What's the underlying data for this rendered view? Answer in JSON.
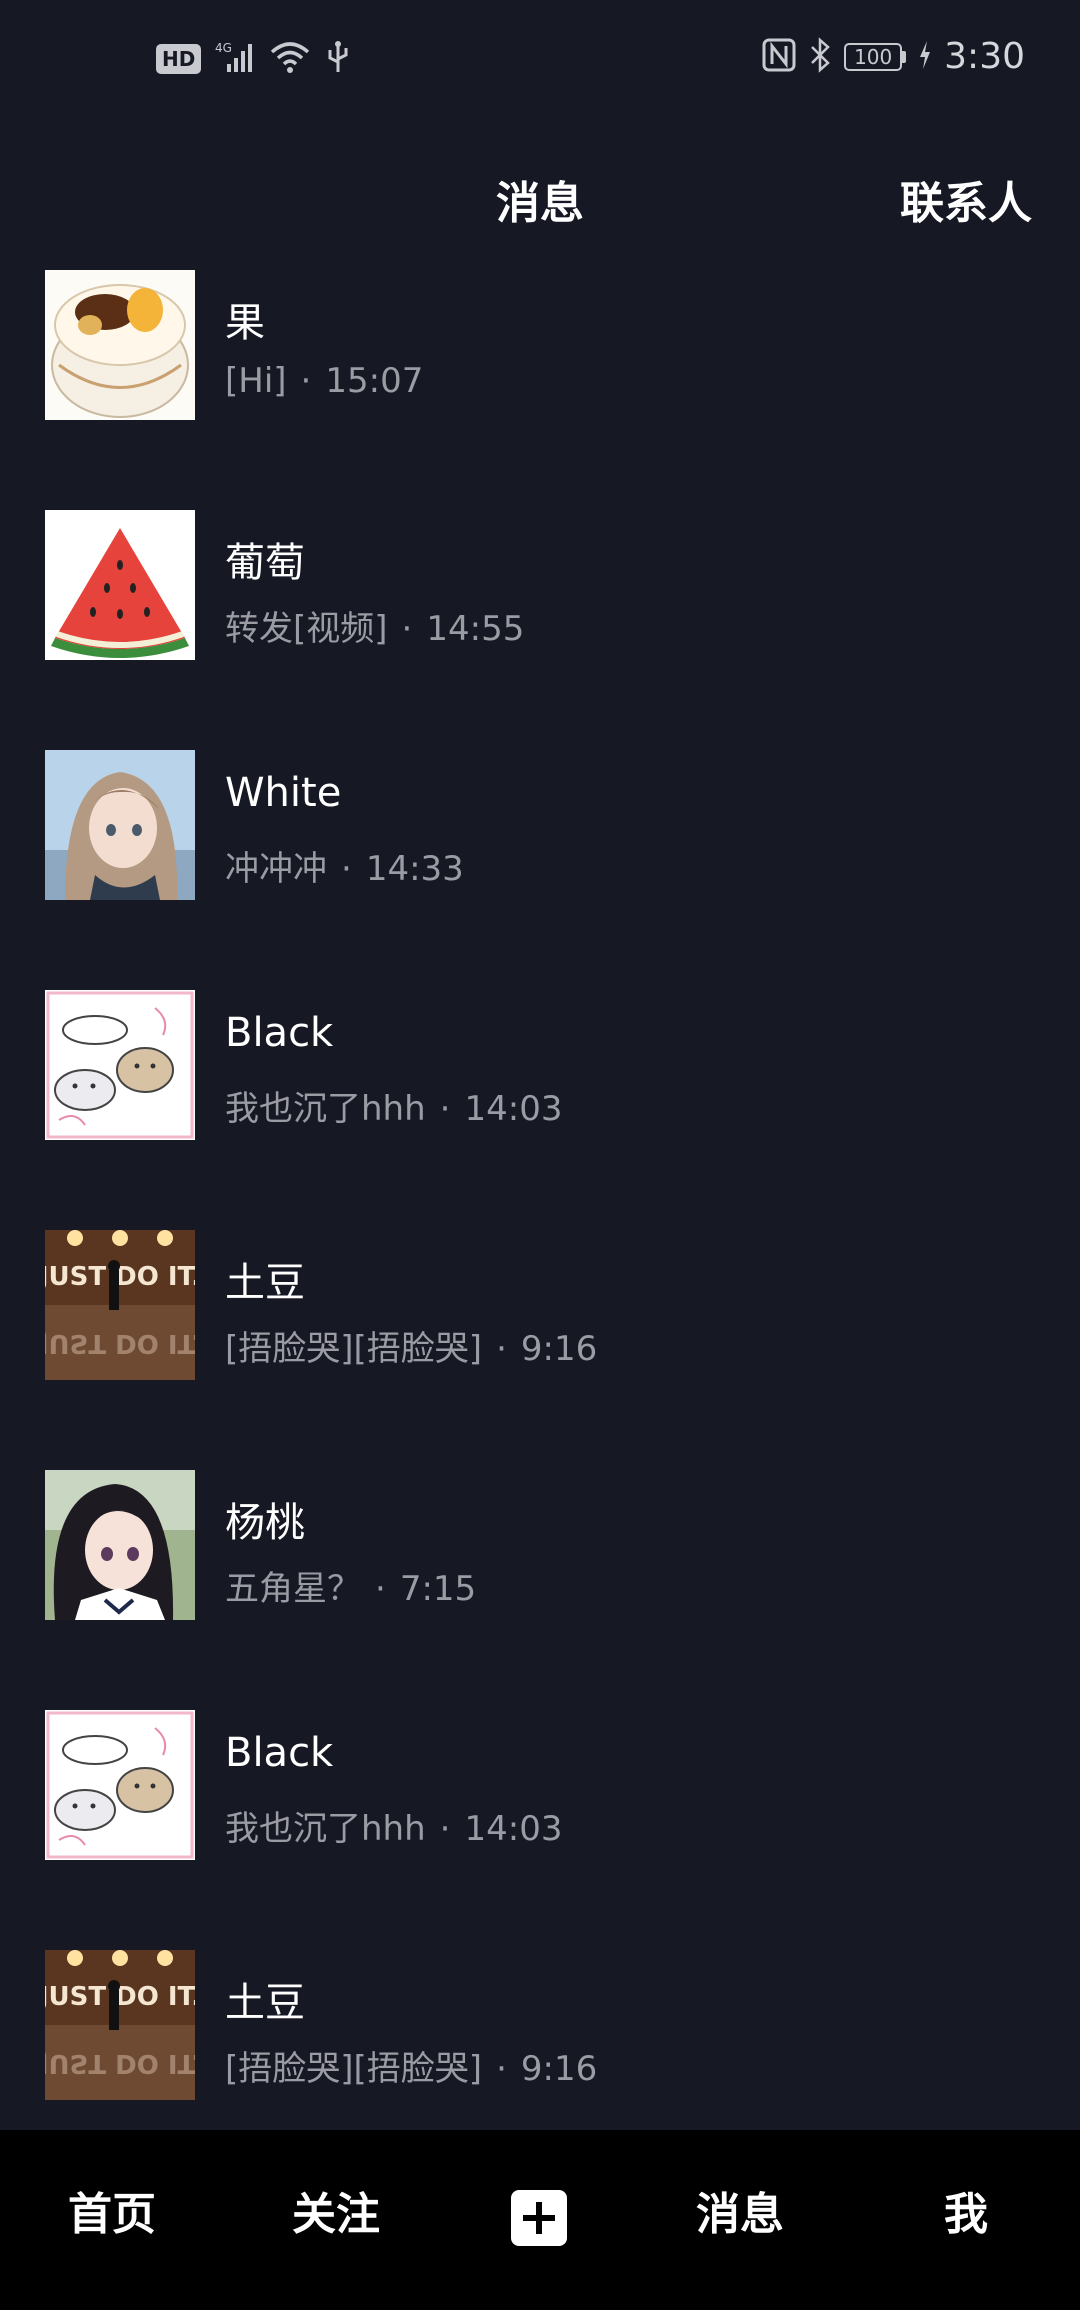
{
  "status_bar": {
    "hd": "HD",
    "network": "4G",
    "battery": "100",
    "time": "3:30"
  },
  "header": {
    "title": "消息",
    "contacts": "联系人"
  },
  "messages": [
    {
      "name": "果",
      "preview": "[Hi]",
      "time": "15:07",
      "avatar": "cake"
    },
    {
      "name": "葡萄",
      "preview": "转发[视频]",
      "time": "14:55",
      "avatar": "watermelon"
    },
    {
      "name": "White",
      "preview": "冲冲冲",
      "time": "14:33",
      "avatar": "anime-girl"
    },
    {
      "name": "Black",
      "preview": "我也沉了hhh",
      "time": "14:03",
      "avatar": "cats"
    },
    {
      "name": "土豆",
      "preview": "[捂脸哭][捂脸哭]",
      "time": "9:16",
      "avatar": "just-do-it"
    },
    {
      "name": "杨桃",
      "preview": "五角星？",
      "time": "7:15",
      "avatar": "anime-girl-dark"
    },
    {
      "name": "Black",
      "preview": "我也沉了hhh",
      "time": "14:03",
      "avatar": "cats"
    },
    {
      "name": "土豆",
      "preview": "[捂脸哭][捂脸哭]",
      "time": "9:16",
      "avatar": "just-do-it"
    }
  ],
  "separator": "·",
  "avatar_text": {
    "just_do_it": "JUST DO IT."
  },
  "nav": {
    "home": "首页",
    "follow": "关注",
    "messages": "消息",
    "me": "我"
  },
  "colors": {
    "background": "#161824",
    "nav_background": "#000000",
    "secondary_text": "#9a9ba3"
  }
}
